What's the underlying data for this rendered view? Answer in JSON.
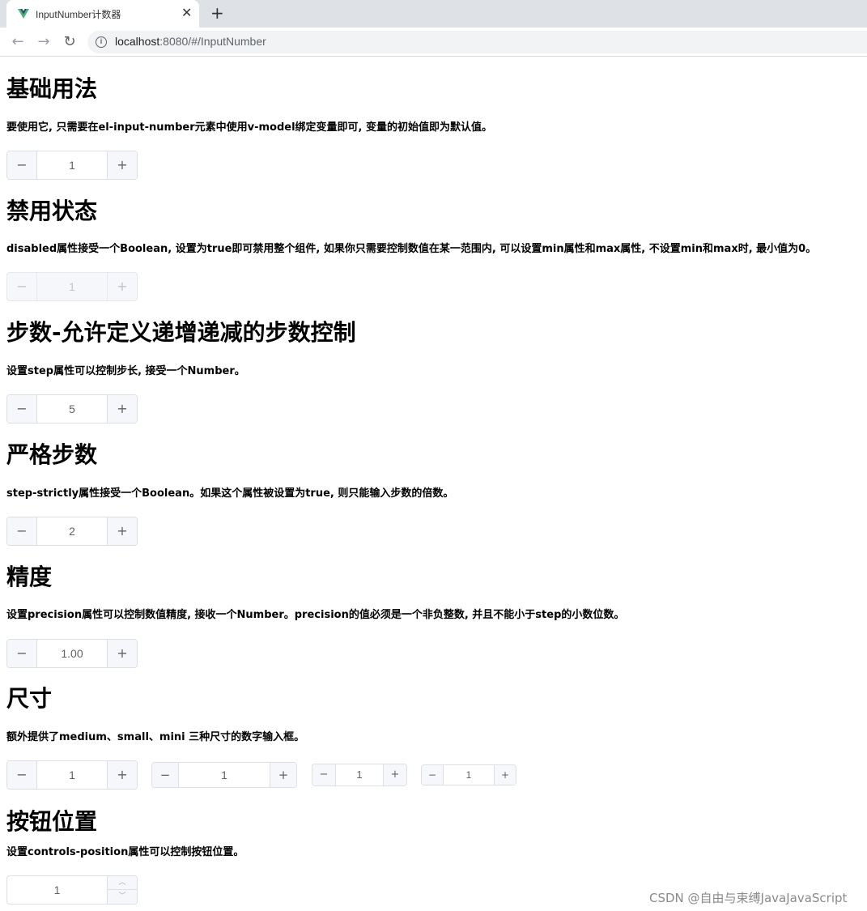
{
  "browser": {
    "tab_title": "InputNumber计数器",
    "tab_close": "✕",
    "new_tab": "+",
    "back": "←",
    "forward": "→",
    "reload": "↻",
    "info": "i",
    "url_host": "localhost",
    "url_path": ":8080/#/InputNumber",
    "brand_color": "#41b883"
  },
  "controls": {
    "minus": "−",
    "plus": "+",
    "up": "︿",
    "down": "﹀"
  },
  "sections": {
    "basic": {
      "title": "基础用法",
      "desc": "要使用它, 只需要在el-input-number元素中使用v-model绑定变量即可, 变量的初始值即为默认值。",
      "value": "1"
    },
    "disabled": {
      "title": "禁用状态",
      "desc": "disabled属性接受一个Boolean, 设置为true即可禁用整个组件, 如果你只需要控制数值在某一范围内, 可以设置min属性和max属性, 不设置min和max时, 最小值为0。",
      "value": "1"
    },
    "step": {
      "title": "步数-允许定义递增递减的步数控制",
      "desc": "设置step属性可以控制步长, 接受一个Number。",
      "value": "5"
    },
    "strict": {
      "title": "严格步数",
      "desc": "step-strictly属性接受一个Boolean。如果这个属性被设置为true, 则只能输入步数的倍数。",
      "value": "2"
    },
    "precision": {
      "title": "精度",
      "desc": "设置precision属性可以控制数值精度, 接收一个Number。precision的值必须是一个非负整数, 并且不能小于step的小数位数。",
      "value": "1.00"
    },
    "size": {
      "title": "尺寸",
      "desc": "额外提供了medium、small、mini 三种尺寸的数字输入框。",
      "values": [
        "1",
        "1",
        "1",
        "1"
      ]
    },
    "position": {
      "title": "按钮位置",
      "desc": "设置controls-position属性可以控制按钮位置。",
      "value": "1"
    }
  },
  "watermark": "CSDN @自由与束缚JavaJavaScript"
}
